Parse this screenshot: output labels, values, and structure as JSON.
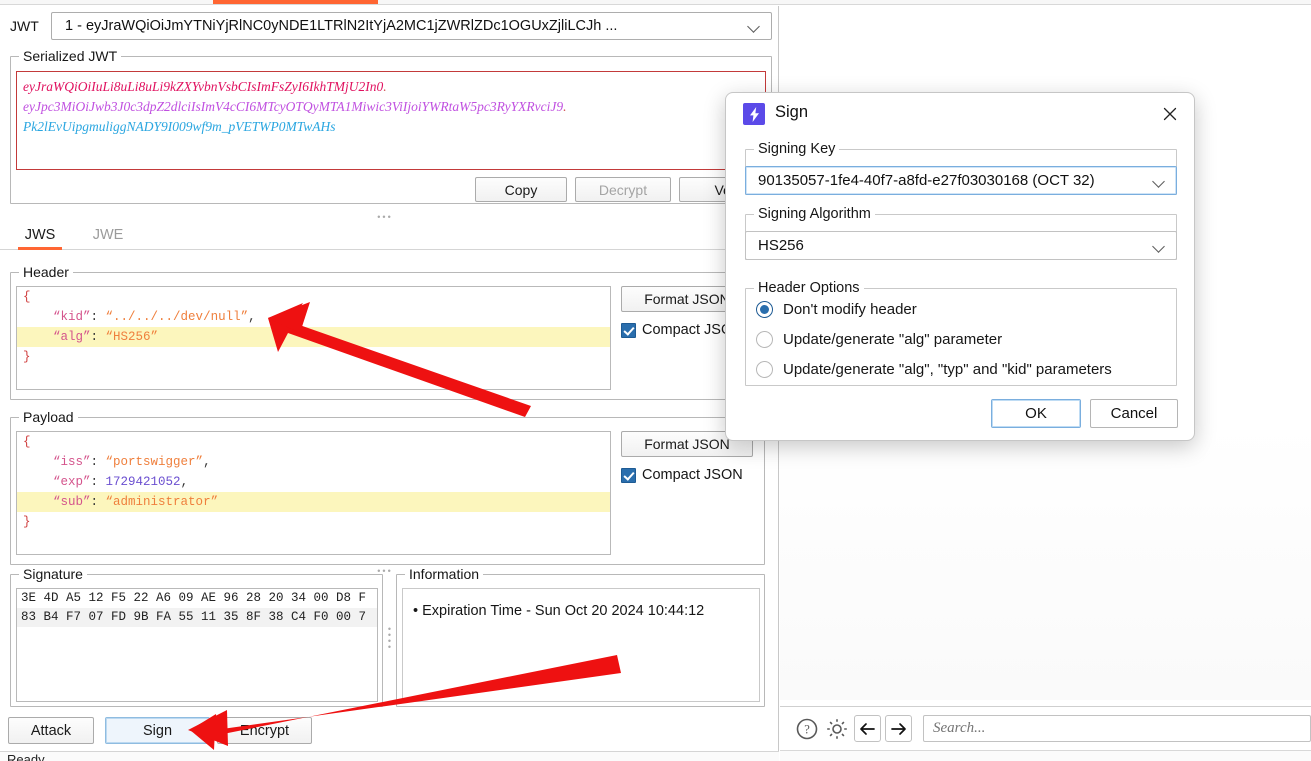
{
  "window": {
    "status_text": "Ready"
  },
  "jwt_selector": {
    "label": "JWT",
    "value": "1 - eyJraWQiOiJmYTNiYjRlNC0yNDE1LTRlN2ItYjA2MC1jZWRlZDc1OGUxZjliLCJh ...",
    "chevron_icon": "chevron-down-icon"
  },
  "serialized": {
    "legend": "Serialized JWT",
    "part1": "eyJraWQiOiIuLi8uLi8uLi9kZXYvbnVsbCIsImFsZyI6IkhTMjU2In0",
    "part2": "eyJpc3MiOiJwb3J0c3dpZ2dlciIsImV4cCI6MTcyOTQyMTA1Miwic3ViIjoiYWRtaW5pc3RyYXRvciJ9",
    "part3": "Pk2lEvUipgmuliggNADY9I009wf9m_pVETWP0MTwAHs",
    "buttons": {
      "copy": "Copy",
      "decrypt": "Decrypt",
      "verify": "Ver"
    }
  },
  "subtabs": [
    {
      "label": "JWS",
      "active": true
    },
    {
      "label": "JWE",
      "active": false
    }
  ],
  "header_section": {
    "legend": "Header",
    "lines": [
      {
        "text": "{",
        "kind": "brace",
        "highlight": false
      },
      {
        "key": "“kid”",
        "value": "“../../../dev/null”",
        "trailing": ",",
        "kind": "str",
        "highlight": false
      },
      {
        "key": "“alg”",
        "value": "“HS256”",
        "trailing": "",
        "kind": "str",
        "highlight": true
      },
      {
        "text": "}",
        "kind": "brace",
        "highlight": false
      }
    ],
    "format_button": "Format JSON",
    "compact_label": "Compact JSON",
    "compact_checked": true
  },
  "payload_section": {
    "legend": "Payload",
    "lines": [
      {
        "text": "{",
        "kind": "brace",
        "highlight": false
      },
      {
        "key": "“iss”",
        "value": "“portswigger”",
        "trailing": ",",
        "kind": "str",
        "highlight": false
      },
      {
        "key": "“exp”",
        "value": "1729421052",
        "trailing": ",",
        "kind": "num",
        "highlight": false
      },
      {
        "key": "“sub”",
        "value": "“administrator”",
        "trailing": "",
        "kind": "str",
        "highlight": true
      },
      {
        "text": "}",
        "kind": "brace",
        "highlight": false
      }
    ],
    "format_button": "Format JSON",
    "compact_label": "Compact JSON",
    "compact_checked": true
  },
  "signature_section": {
    "legend": "Signature",
    "lines": [
      "3E 4D A5 12 F5 22 A6 09 AE 96 28 20 34 00 D8 F",
      "83 B4 F7 07 FD 9B FA 55 11 35 8F 38 C4 F0 00 7"
    ]
  },
  "information_section": {
    "legend": "Information",
    "items": [
      "Expiration Time - Sun Oct 20 2024 10:44:12"
    ]
  },
  "bottom_buttons": {
    "attack": "Attack",
    "sign": "Sign",
    "encrypt": "Encrypt"
  },
  "right_toolbar": {
    "help_icon": "help-circle-icon",
    "settings_icon": "gear-icon",
    "back_icon": "arrow-left-icon",
    "forward_icon": "arrow-right-icon",
    "search_placeholder": "Search...",
    "search_value": ""
  },
  "sign_dialog": {
    "title": "Sign",
    "title_icon": "lightning-bolt-icon",
    "close_icon": "close-icon",
    "signing_key": {
      "legend": "Signing Key",
      "value": "90135057-1fe4-40f7-a8fd-e27f03030168 (OCT 32)",
      "chevron_icon": "chevron-down-icon"
    },
    "signing_algorithm": {
      "legend": "Signing Algorithm",
      "value": "HS256",
      "chevron_icon": "chevron-down-icon"
    },
    "header_options": {
      "legend": "Header Options",
      "options": [
        {
          "label": "Don't modify header",
          "checked": true
        },
        {
          "label": "Update/generate \"alg\" parameter",
          "checked": false
        },
        {
          "label": "Update/generate \"alg\", \"typ\" and \"kid\" parameters",
          "checked": false
        }
      ]
    },
    "ok_button": "OK",
    "cancel_button": "Cancel"
  },
  "annotations": {
    "accent_color": "#ff6633",
    "arrow_color": "#ee1111",
    "arrow_count": 2
  }
}
